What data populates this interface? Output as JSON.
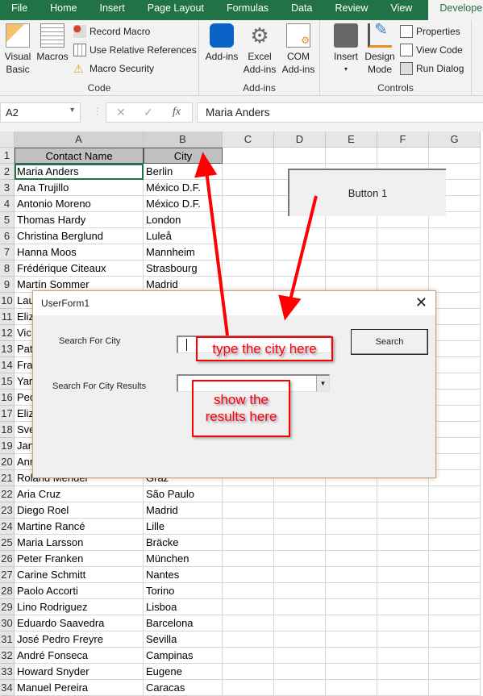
{
  "ribbon": {
    "tabs": [
      "File",
      "Home",
      "Insert",
      "Page Layout",
      "Formulas",
      "Data",
      "Review",
      "View",
      "Developer"
    ],
    "active_tab": "Developer",
    "code": {
      "label": "Code",
      "visual_basic": "Visual Basic",
      "macros": "Macros",
      "record_macro": "Record Macro",
      "relative": "Use Relative References",
      "security": "Macro Security"
    },
    "addins": {
      "label": "Add-ins",
      "addins": "Add-ins",
      "excel_addins": "Excel Add-ins",
      "com_addins": "COM Add-ins"
    },
    "controls": {
      "label": "Controls",
      "insert": "Insert",
      "design_mode": "Design Mode",
      "properties": "Properties",
      "view_code": "View Code",
      "run_dialog": "Run Dialog"
    }
  },
  "formula_bar": {
    "name_box": "A2",
    "cancel": "✕",
    "enter": "✓",
    "fx": "fx",
    "value": "Maria Anders"
  },
  "columns": [
    "A",
    "B",
    "C",
    "D",
    "E",
    "F",
    "G"
  ],
  "rows": [
    [
      "Contact Name",
      "City"
    ],
    [
      "Maria Anders",
      "Berlin"
    ],
    [
      "Ana Trujillo",
      "México D.F."
    ],
    [
      "Antonio Moreno",
      "México D.F."
    ],
    [
      "Thomas Hardy",
      "London"
    ],
    [
      "Christina Berglund",
      "Luleå"
    ],
    [
      "Hanna Moos",
      "Mannheim"
    ],
    [
      "Frédérique Citeaux",
      "Strasbourg"
    ],
    [
      "Martín Sommer",
      "Madrid"
    ],
    [
      "Lau",
      ""
    ],
    [
      "Eliz",
      ""
    ],
    [
      "Vic",
      ""
    ],
    [
      "Pat",
      ""
    ],
    [
      "Fra",
      ""
    ],
    [
      "Yar",
      ""
    ],
    [
      "Peo",
      ""
    ],
    [
      "Eliz",
      ""
    ],
    [
      "Sve",
      ""
    ],
    [
      "Jan",
      ""
    ],
    [
      "Ann",
      ""
    ],
    [
      "Roland Mendel",
      "Graz"
    ],
    [
      "Aria Cruz",
      "São Paulo"
    ],
    [
      "Diego Roel",
      "Madrid"
    ],
    [
      "Martine Rancé",
      "Lille"
    ],
    [
      "Maria Larsson",
      "Bräcke"
    ],
    [
      "Peter Franken",
      "München"
    ],
    [
      "Carine Schmitt",
      "Nantes"
    ],
    [
      "Paolo Accorti",
      "Torino"
    ],
    [
      "Lino Rodriguez",
      "Lisboa"
    ],
    [
      "Eduardo Saavedra",
      "Barcelona"
    ],
    [
      "José Pedro Freyre",
      "Sevilla"
    ],
    [
      "André Fonseca",
      "Campinas"
    ],
    [
      "Howard Snyder",
      "Eugene"
    ],
    [
      "Manuel Pereira",
      "Caracas"
    ]
  ],
  "sheet_button": "Button 1",
  "userform": {
    "title": "UserForm1",
    "close": "✕",
    "label_city": "Search For City",
    "label_results": "Search For City Results",
    "city_value": "",
    "search_button": "Search",
    "results_value": ""
  },
  "annotations": {
    "type_city": "type the city here",
    "show_results": "show the results here",
    "color": "#ff0000"
  },
  "colors": {
    "ribbon_green": "#217346"
  }
}
